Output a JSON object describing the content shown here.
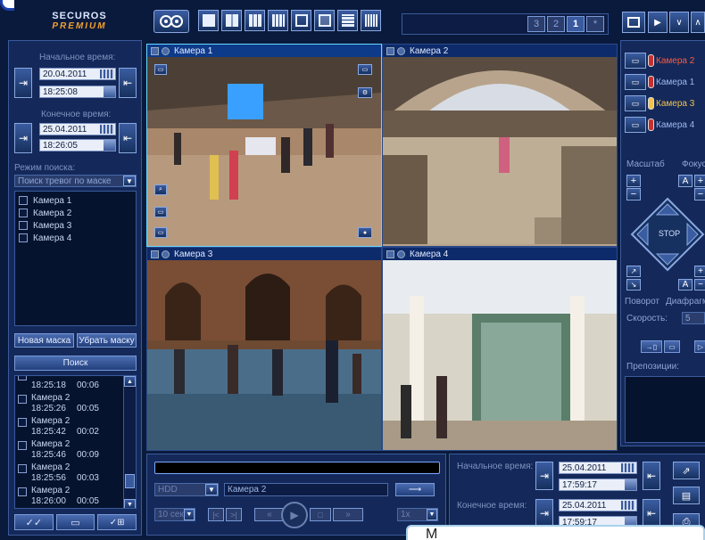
{
  "brand": {
    "line1": "SECUROS",
    "line2": "PREMIUM"
  },
  "left": {
    "start_label": "Начальное время:",
    "start_date": "20.04.2011",
    "start_time": "18:25:08",
    "end_label": "Конечное время:",
    "end_date": "25.04.2011",
    "end_time": "18:26:05",
    "mode_label": "Режим поиска:",
    "mode_value": "Поиск тревог по маске",
    "cameras": [
      "Камера 1",
      "Камера 2",
      "Камера 3",
      "Камера 4"
    ],
    "new_mask": "Новая маска",
    "remove_mask": "Убрать маску",
    "search": "Поиск",
    "results": [
      {
        "cam": "",
        "time": "18:25:18",
        "dur": "00:06"
      },
      {
        "cam": "Камера 2",
        "time": "18:25:26",
        "dur": "00:05"
      },
      {
        "cam": "Камера 2",
        "time": "18:25:42",
        "dur": "00:02"
      },
      {
        "cam": "Камера 2",
        "time": "18:25:46",
        "dur": "00:09"
      },
      {
        "cam": "Камера 2",
        "time": "18:25:56",
        "dur": "00:03"
      },
      {
        "cam": "Камера 2",
        "time": "18:26:00",
        "dur": "00:05"
      }
    ]
  },
  "pages": [
    "3",
    "2",
    "1",
    "*"
  ],
  "video": {
    "cells": [
      {
        "title": "Камера 1"
      },
      {
        "title": "Камера 2"
      },
      {
        "title": "Камера 3"
      },
      {
        "title": "Камера 4"
      }
    ]
  },
  "right": {
    "cameras": [
      {
        "label": "Камера 2",
        "color": "#ff5a3c"
      },
      {
        "label": "Камера 1",
        "color": "#9fb8f0"
      },
      {
        "label": "Камера 3",
        "color": "#f3c34a"
      },
      {
        "label": "Камера 4",
        "color": "#9fb8f0"
      }
    ],
    "scale": "Масштаб",
    "focus": "Фокус",
    "stop": "STOP",
    "rotate": "Поворот",
    "iris": "Диафрагма",
    "speed_label": "Скорость:",
    "speed_value": "5",
    "presets": "Препозиции:"
  },
  "bottom": {
    "source": "HDD",
    "camera": "Камера 2",
    "step": "10 сек",
    "rate": "1x",
    "start_label": "Начальное время:",
    "start_date": "25.04.2011",
    "start_time": "17:59:17",
    "end_label": "Конечное время:",
    "end_date": "25.04.2011",
    "end_time": "17:59:17"
  },
  "tooltip": "M"
}
